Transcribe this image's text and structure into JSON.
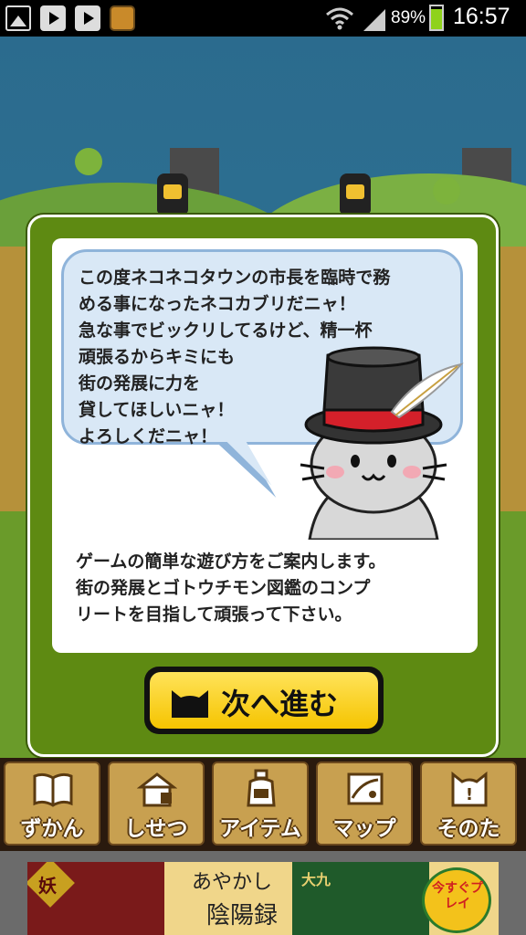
{
  "status_bar": {
    "battery": "89%",
    "time": "16:57"
  },
  "dialog": {
    "bubble_lines": [
      "この度ネコネコタウンの市長を臨時で務",
      "める事になったネコカブリだニャ！",
      "急な事でビックリしてるけど、精一杯",
      "頑張るからキミにも",
      "街の発展に力を",
      "貸してほしいニャ！",
      "よろしくだニャ！"
    ],
    "info_lines": [
      "ゲームの簡単な遊び方をご案内します。",
      "街の発展とゴトウチモン図鑑のコンプ",
      "リートを目指して頑張って下さい。"
    ],
    "next_label": "次へ進む"
  },
  "menu": {
    "items": [
      {
        "label": "ずかん",
        "icon": "book-icon"
      },
      {
        "label": "しせつ",
        "icon": "facility-icon"
      },
      {
        "label": "アイテム",
        "icon": "item-icon"
      },
      {
        "label": "マップ",
        "icon": "map-icon"
      },
      {
        "label": "そのた",
        "icon": "other-icon"
      }
    ]
  },
  "ad": {
    "badge_left": "妖",
    "title1": "あやかし",
    "title2": "陰陽録",
    "badge_mid": "大九",
    "cta": "今すぐプレイ"
  },
  "colors": {
    "modal_green": "#5e8a12",
    "bubble_fill": "#d9e8f6",
    "button_yellow": "#f5c400",
    "menu_tan": "#c8a050"
  }
}
